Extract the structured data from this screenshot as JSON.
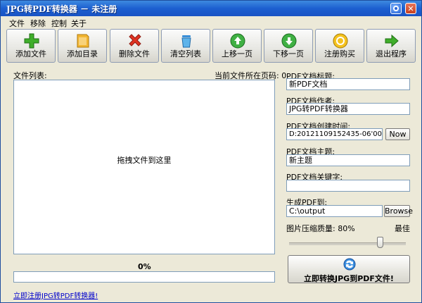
{
  "window": {
    "title": "JPG转PDF转换器 － 未注册"
  },
  "menu": [
    "文件",
    "移除",
    "控制",
    "关于"
  ],
  "toolbar": [
    {
      "label": "添加文件",
      "icon": "add-file-icon"
    },
    {
      "label": "添加目录",
      "icon": "add-folder-icon"
    },
    {
      "label": "删除文件",
      "icon": "delete-icon"
    },
    {
      "label": "清空列表",
      "icon": "clear-list-icon"
    },
    {
      "label": "上移一页",
      "icon": "move-up-icon"
    },
    {
      "label": "下移一页",
      "icon": "move-down-icon"
    },
    {
      "label": "注册购买",
      "icon": "register-icon"
    },
    {
      "label": "退出程序",
      "icon": "exit-icon"
    }
  ],
  "file_list": {
    "label": "文件列表:",
    "page_info": "当前文件所在页码: 0",
    "drop_hint": "拖拽文件到这里"
  },
  "progress": {
    "text": "0%",
    "value": 0
  },
  "form": {
    "title_label": "PDF文档标题:",
    "title_value": "新PDF文档",
    "author_label": "PDF文档作者:",
    "author_value": "JPG转PDF转换器",
    "created_label": "PDF文档创建时间:",
    "created_value": "D:20121109152435-06'00",
    "now_button": "Now",
    "subject_label": "PDF文档主题:",
    "subject_value": "新主题",
    "keywords_label": "PDF文档关键字:",
    "keywords_value": "",
    "output_label": "生成PDF到:",
    "output_value": "C:\\output",
    "browse_button": "Browse",
    "quality_label": "图片压缩质量: 80%",
    "quality_best": "最佳",
    "quality_value": 80
  },
  "convert_button": "立即转换JPG到PDF文件!",
  "register_link": "立即注册JPG转PDF转换器!"
}
